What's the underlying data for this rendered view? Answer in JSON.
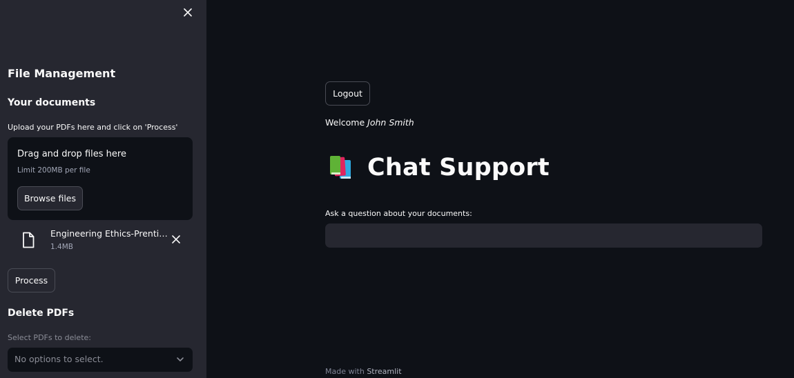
{
  "sidebar": {
    "section_title": "File Management",
    "documents_heading": "Your documents",
    "upload_label": "Upload your PDFs here and click on 'Process'",
    "dropzone": {
      "title": "Drag and drop files here",
      "limit": "Limit 200MB per file",
      "browse_label": "Browse files"
    },
    "uploaded_file": {
      "name": "Engineering Ethics-Prentice Hall.pdf",
      "size": "1.4MB"
    },
    "process_label": "Process",
    "delete_heading": "Delete PDFs",
    "delete_label": "Select PDFs to delete:",
    "delete_select_placeholder": "No options to select."
  },
  "main": {
    "logout_label": "Logout",
    "welcome_prefix": "Welcome",
    "user_name": "John Smith",
    "title": "Chat Support",
    "question_label": "Ask a question about your documents:",
    "question_value": "",
    "footer_prefix": "Made with",
    "footer_brand": "Streamlit"
  },
  "icons": {
    "close": "close-icon",
    "file": "file-icon",
    "remove": "close-icon",
    "chevron": "chevron-down-icon",
    "books": "books-emoji-icon"
  },
  "colors": {
    "background": "#0e1117",
    "sidebar": "#262730",
    "text": "#fafafa"
  }
}
